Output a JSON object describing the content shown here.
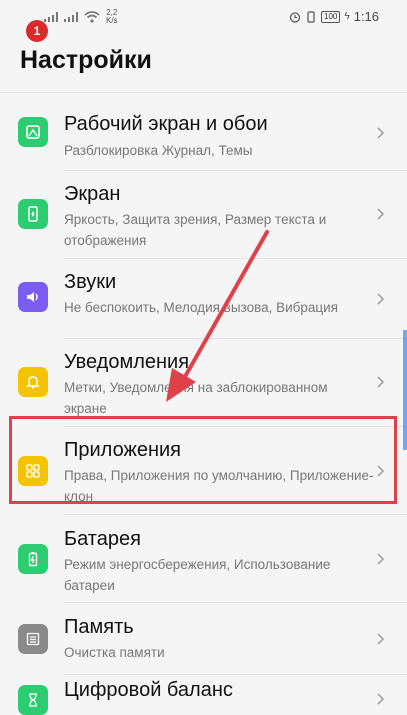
{
  "status": {
    "speed_top": "2,2",
    "speed_bottom": "K/s",
    "battery": "100",
    "time": "1:16"
  },
  "step_badge": "1",
  "page_title": "Настройки",
  "items": [
    {
      "title": "Рабочий экран и обои",
      "subtitle": "Разблокировка Журнал, Темы",
      "icon": "wallpaper-icon",
      "color": "#2ecc71"
    },
    {
      "title": "Экран",
      "subtitle": "Яркость, Защита зрения, Размер текста и отображения",
      "icon": "display-icon",
      "color": "#2ecc71"
    },
    {
      "title": "Звуки",
      "subtitle": "Не беспокоить, Мелодия вызова, Вибрация",
      "icon": "sound-icon",
      "color": "#7a5cf0"
    },
    {
      "title": "Уведомления",
      "subtitle": "Метки, Уведомления на заблокированном экране",
      "icon": "bell-icon",
      "color": "#f5c400"
    },
    {
      "title": "Приложения",
      "subtitle": "Права, Приложения по умолчанию, Приложение-клон",
      "icon": "apps-icon",
      "color": "#f5c400"
    },
    {
      "title": "Батарея",
      "subtitle": "Режим энергосбережения, Использование батареи",
      "icon": "battery-icon",
      "color": "#2ecc71"
    },
    {
      "title": "Память",
      "subtitle": "Очистка памяти",
      "icon": "storage-icon",
      "color": "#8a8a8a"
    },
    {
      "title": "Цифровой баланс",
      "subtitle": "",
      "icon": "hourglass-icon",
      "color": "#2ecc71"
    }
  ]
}
